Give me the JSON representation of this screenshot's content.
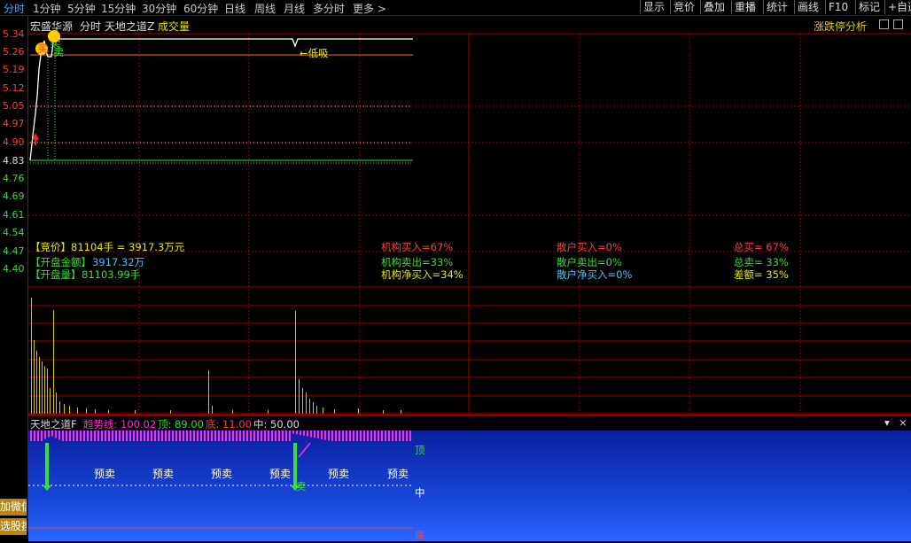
{
  "topbar": {
    "periods": [
      "分时",
      "1分钟",
      "5分钟",
      "15分钟",
      "30分钟",
      "60分钟",
      "日线",
      "周线",
      "月线",
      "多分时",
      "更多 >"
    ],
    "right_buttons": [
      "显示",
      "竞价",
      "叠加",
      "重播",
      "统计",
      "画线",
      "F10",
      "标记",
      "+自选"
    ]
  },
  "header": {
    "stock_name": "宏盛华源",
    "mode": "分时",
    "indicator": "天地之道Z",
    "volume_label": "成交量",
    "analysis": "涨跌停分析"
  },
  "y_axis": {
    "ticks": [
      "5.34",
      "5.26",
      "5.19",
      "5.12",
      "5.05",
      "4.97",
      "4.90",
      "4.83",
      "4.76",
      "4.69",
      "4.61",
      "4.54",
      "4.47",
      "4.40"
    ]
  },
  "annotations": {
    "buy": "买",
    "sell": "卖",
    "sell_top": "卖",
    "low_absorb": "←低吸"
  },
  "info": {
    "bid": "【竞价】81104手 = 3917.3万元",
    "open_amount_label": "【开盘金额】",
    "open_amount_value": "3917.32万",
    "open_vol_label": "【开盘量】",
    "open_vol_value": "81103.99手",
    "inst_buy": "机构买入=67%",
    "inst_sell": "机构卖出=33%",
    "inst_net": "机构净买入=34%",
    "retail_buy": "散户买入=0%",
    "retail_sell": "散户卖出=0%",
    "retail_net": "散户净买入=0%",
    "total_buy": "总买= 67%",
    "total_sell": "总卖= 33%",
    "diff": "差额= 35%"
  },
  "indicator_panel": {
    "name": "天地之道F",
    "trend_label": "趋势线: 100.02",
    "top_label": "顶: 89.00",
    "bottom_label": "底: 11.00",
    "mid_label": "中: 50.00",
    "yumai": [
      "预卖",
      "预卖",
      "预卖",
      "预卖",
      "预卖",
      "预卖"
    ],
    "sell_mark": "卖",
    "ding": "顶",
    "zhong": "中",
    "di": "底"
  },
  "side_buttons": [
    "加微信",
    "选股搜"
  ],
  "colors": {
    "up": "#ff4040",
    "down": "#3ddc3d",
    "grid": "#a00000",
    "yellow": "#e8e800",
    "cyan": "#40c8ff"
  }
}
